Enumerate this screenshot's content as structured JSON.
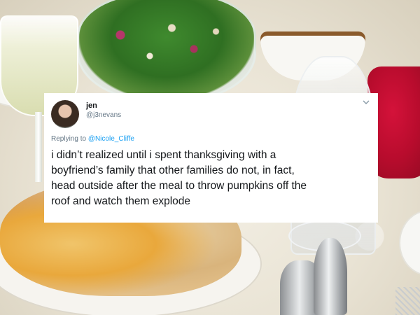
{
  "tweet": {
    "display_name": "jen",
    "handle": "@j3nevans",
    "reply_prefix": "Replying to ",
    "reply_mention": "@Nicole_Cliffe",
    "text_lines": [
      "i didn’t realized until i spent thanksgiving with a",
      "boyfriend’s family that other families do not, in fact,",
      "head outside after the meal to throw pumpkins off the",
      "roof and watch them explode"
    ],
    "menu_icon": "chevron-down-icon"
  },
  "colors": {
    "text_primary": "#14171a",
    "text_secondary": "#657786",
    "link": "#1da1f2",
    "card_background": "#ffffff"
  }
}
